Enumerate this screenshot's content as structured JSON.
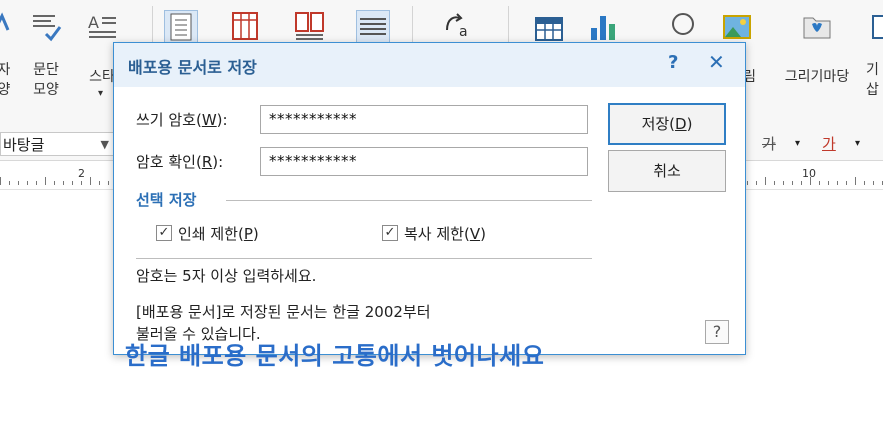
{
  "ribbon": {
    "items": [
      {
        "label": "자\n양",
        "icon": "char-shape-icon"
      },
      {
        "label": "문단\n모양",
        "icon": "paragraph-shape-icon"
      },
      {
        "label": "스타",
        "icon": "style-icon"
      },
      {
        "label": "",
        "icon": "page-icon"
      },
      {
        "label": "",
        "icon": "table-page-icon"
      },
      {
        "label": "",
        "icon": "columns-icon"
      },
      {
        "label": "",
        "icon": "lines-icon"
      },
      {
        "label": "",
        "icon": "text-rotate-icon"
      },
      {
        "label": "",
        "icon": "table-icon"
      },
      {
        "label": "",
        "icon": "chart-icon"
      },
      {
        "label": "",
        "icon": "shapes-icon"
      },
      {
        "label": "림",
        "icon": "picture-icon"
      },
      {
        "label": "그리기마당",
        "icon": "drawing-folder-icon"
      },
      {
        "label": "기\n삽",
        "icon": "more-icon"
      }
    ]
  },
  "fontrow": {
    "font_name": "바탕글",
    "strike_label": "가",
    "color_label": "가"
  },
  "ruler": {
    "num_a": "2",
    "num_b": "10"
  },
  "dialog": {
    "title": "배포용 문서로 저장",
    "help": "?",
    "close": "✕",
    "write_pw_label": "쓰기 암호(",
    "write_pw_key": "W",
    "write_pw_tail": "):",
    "write_pw_value": "***********",
    "confirm_pw_label": "암호 확인(",
    "confirm_pw_key": "R",
    "confirm_pw_tail": "):",
    "confirm_pw_value": "***********",
    "save_label": "저장(",
    "save_key": "D",
    "save_tail": ")",
    "cancel_label": "취소",
    "section_title": "선택 저장",
    "print_label": "인쇄 제한(",
    "print_key": "P",
    "print_tail": ")",
    "print_checked": true,
    "copy_label": "복사 제한(",
    "copy_key": "V",
    "copy_tail": ")",
    "copy_checked": true,
    "hint": "암호는 5자 이상 입력하세요.",
    "note_line1": "[배포용 문서]로 저장된 문서는 한글 2002부터",
    "note_line2": "불러올 수 있습니다.",
    "help_button": "?"
  },
  "caption": "한글 배포용 문서의 고통에서 벗어나세요",
  "colors": {
    "accent": "#2b6fb5",
    "caption": "#2a6dc9",
    "dialog_border": "#3c8fd3"
  }
}
